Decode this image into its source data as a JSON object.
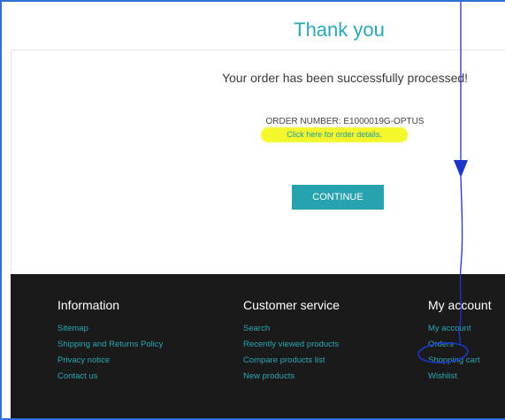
{
  "page": {
    "title": "Thank you",
    "success_message": "Your order has been successfully processed!",
    "order_number_label": "ORDER NUMBER:",
    "order_number_value": "E1000019G-OPTUS",
    "order_details_link": "Click here for order details.",
    "continue_button": "CONTINUE"
  },
  "footer": {
    "information": {
      "heading": "Information",
      "links": [
        "Sitemap",
        "Shipping and Returns Policy",
        "Privacy notice",
        "Contact us"
      ]
    },
    "customer_service": {
      "heading": "Customer service",
      "links": [
        "Search",
        "Recently viewed products",
        "Compare products list",
        "New products"
      ]
    },
    "my_account": {
      "heading": "My account",
      "links": [
        "My account",
        "Orders",
        "Shopping cart",
        "Wishlist"
      ]
    }
  },
  "colors": {
    "accent": "#2aa7b5",
    "highlight": "#f4f82a",
    "annotation": "#1d35c9",
    "footer_bg": "#1a1a1a"
  }
}
